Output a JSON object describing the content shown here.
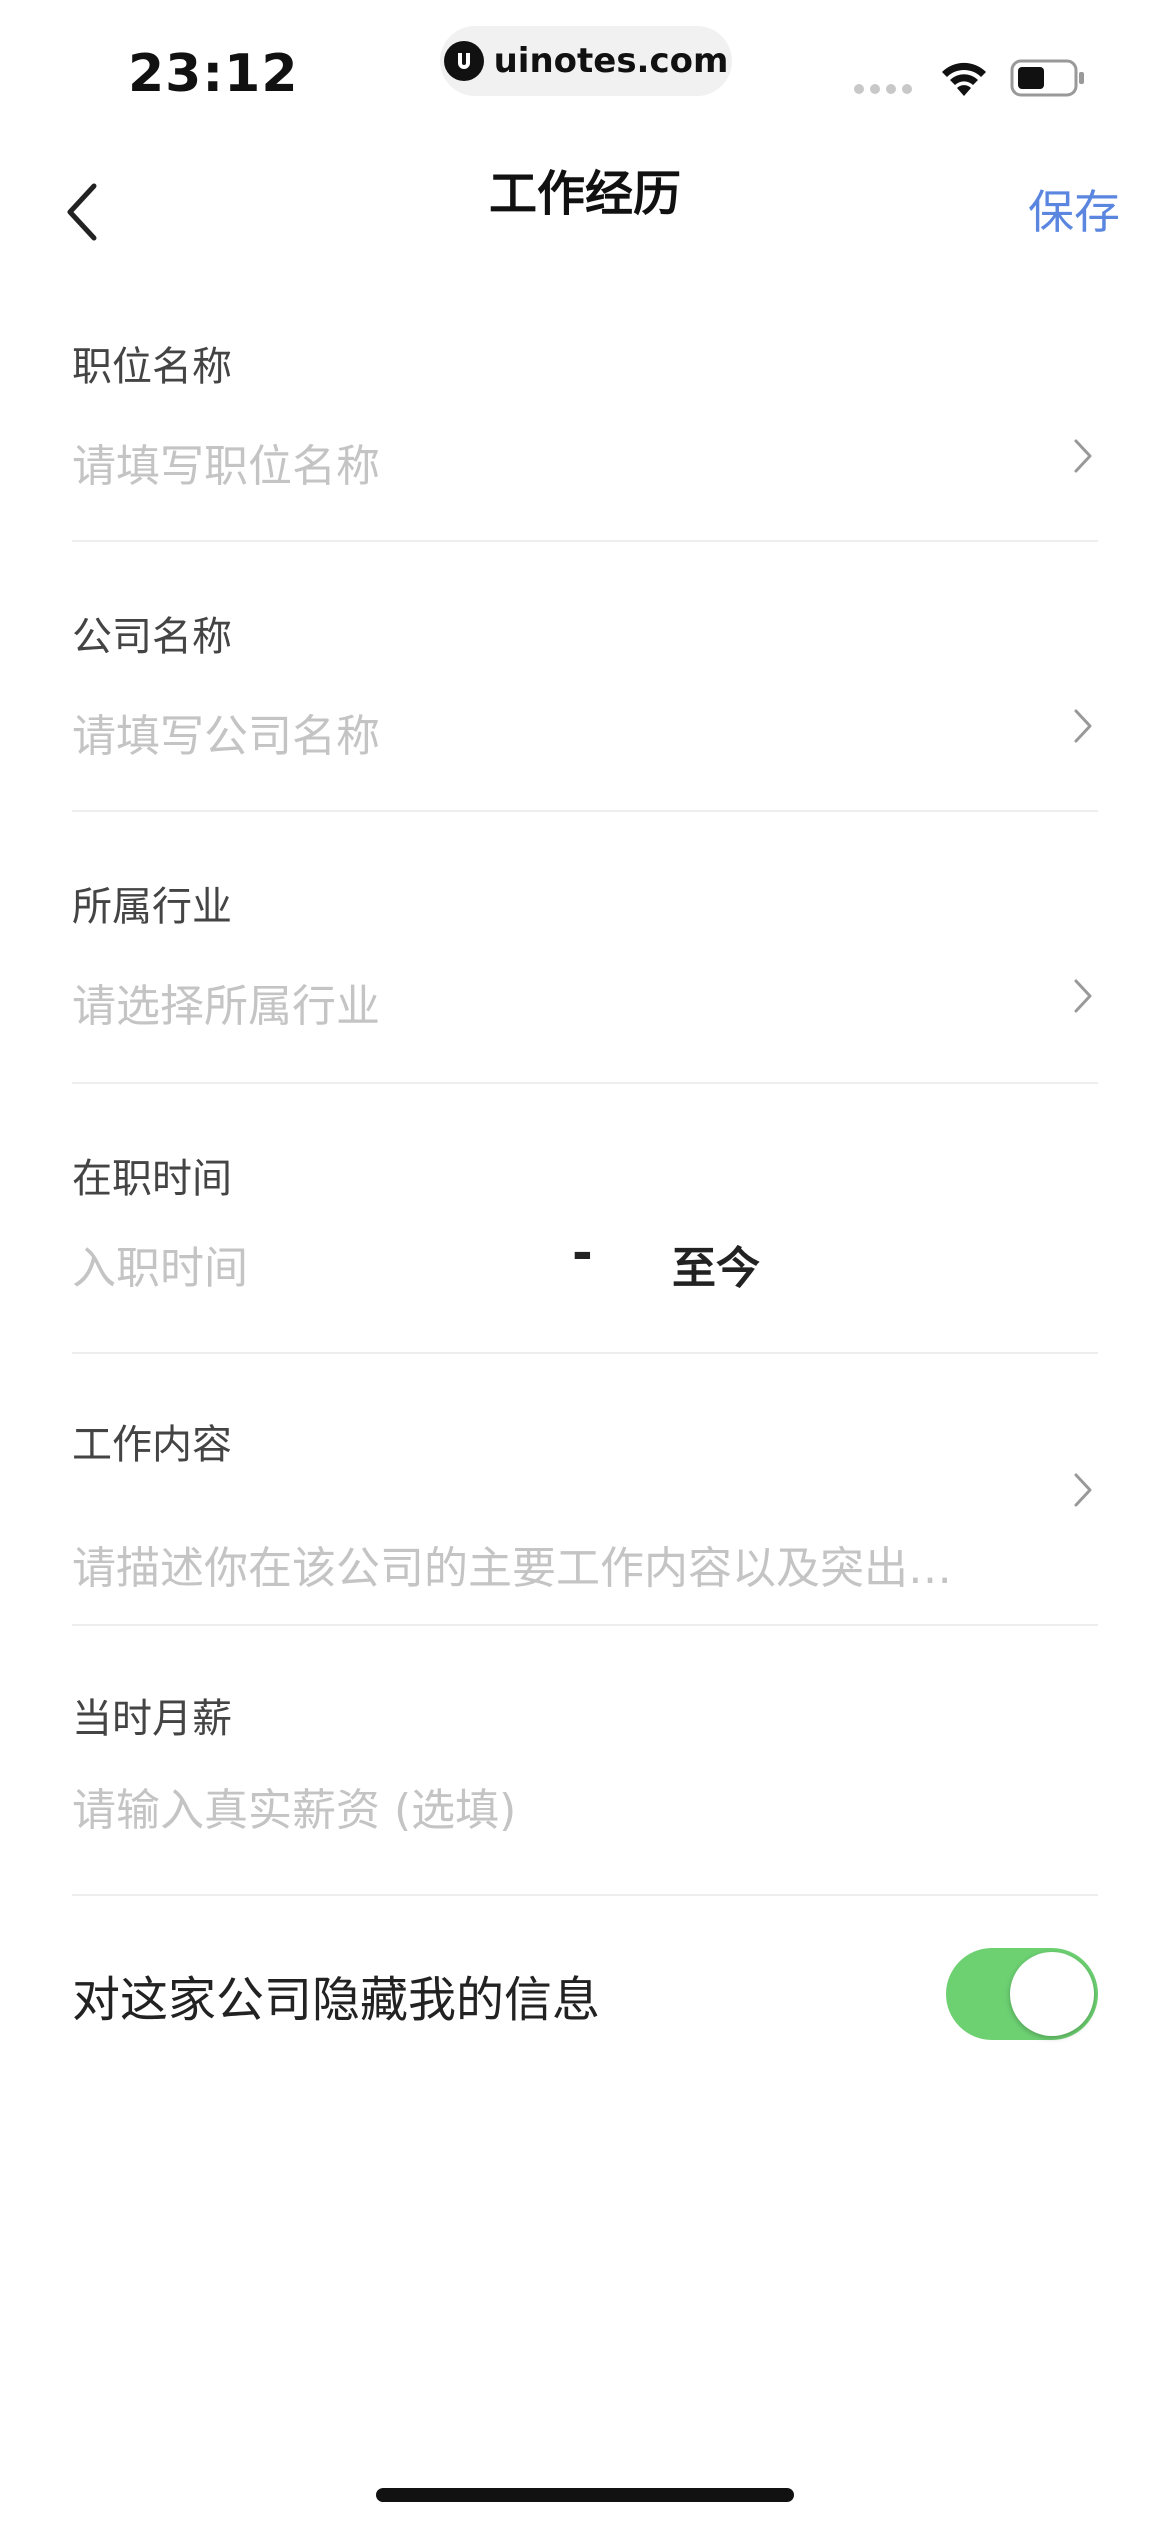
{
  "status_bar": {
    "time": "23:12",
    "url": "uinotes.com"
  },
  "nav": {
    "title": "工作经历",
    "save_label": "保存"
  },
  "form": {
    "position": {
      "label": "职位名称",
      "placeholder": "请填写职位名称"
    },
    "company": {
      "label": "公司名称",
      "placeholder": "请填写公司名称"
    },
    "industry": {
      "label": "所属行业",
      "placeholder": "请选择所属行业"
    },
    "employment_time": {
      "label": "在职时间",
      "start_placeholder": "入职时间",
      "separator": "-",
      "end_value": "至今"
    },
    "work_content": {
      "label": "工作内容",
      "placeholder": "请描述你在该公司的主要工作内容以及突出…"
    },
    "salary": {
      "label": "当时月薪",
      "placeholder": "请输入真实薪资 (选填)"
    }
  },
  "hide_info": {
    "label": "对这家公司隐藏我的信息",
    "enabled": true
  },
  "colors": {
    "accent": "#5b86e0",
    "toggle_on": "#6dd172",
    "placeholder": "#c4c4c4",
    "divider": "#eeeeee"
  }
}
